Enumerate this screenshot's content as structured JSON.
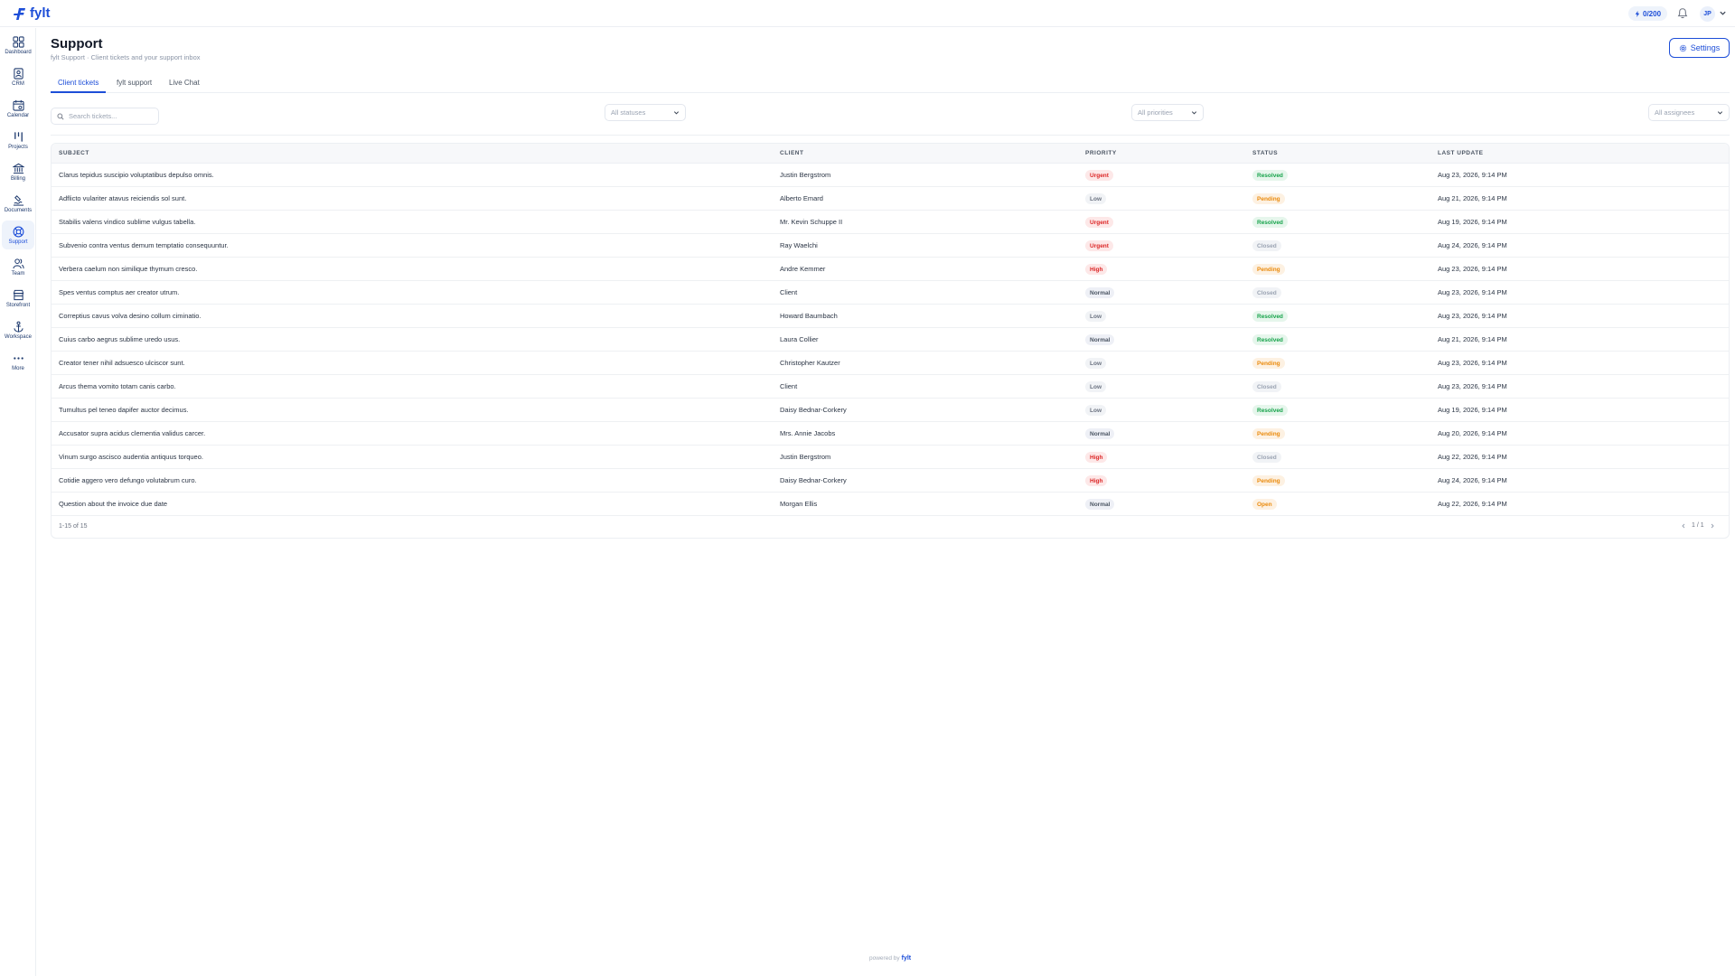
{
  "app": {
    "logo_text": "fylt",
    "credits": "0/200",
    "avatar_initials": "JP"
  },
  "colors": {
    "accent": "#1d4ed8",
    "urgent": "#dc2626",
    "resolved": "#16a34a",
    "pending": "#ea8a0c"
  },
  "sidebar": {
    "items": [
      {
        "label": "Dashboard",
        "icon": "dashboard-icon",
        "active": false
      },
      {
        "label": "CRM",
        "icon": "crm-icon",
        "active": false
      },
      {
        "label": "Calendar",
        "icon": "calendar-icon",
        "active": false
      },
      {
        "label": "Projects",
        "icon": "projects-icon",
        "active": false
      },
      {
        "label": "Billing",
        "icon": "billing-icon",
        "active": false
      },
      {
        "label": "Documents",
        "icon": "documents-icon",
        "active": false
      },
      {
        "label": "Support",
        "icon": "support-icon",
        "active": true
      },
      {
        "label": "Team",
        "icon": "team-icon",
        "active": false
      },
      {
        "label": "Storefront",
        "icon": "storefront-icon",
        "active": false
      },
      {
        "label": "Workspace",
        "icon": "workspace-icon",
        "active": false
      },
      {
        "label": "More",
        "icon": "more-icon",
        "active": false
      }
    ]
  },
  "header": {
    "title": "Support",
    "subtitle": "fylt Support · Client tickets and your support inbox",
    "settings_label": "Settings"
  },
  "tabs": [
    {
      "label": "Client tickets",
      "active": true
    },
    {
      "label": "fylt support",
      "active": false
    },
    {
      "label": "Live Chat",
      "active": false
    }
  ],
  "filters": {
    "search_placeholder": "Search tickets...",
    "status": "All statuses",
    "priority": "All priorities",
    "assignee": "All assignees"
  },
  "table": {
    "columns": [
      "SUBJECT",
      "CLIENT",
      "PRIORITY",
      "STATUS",
      "LAST UPDATE"
    ],
    "rows": [
      {
        "subject": "Clarus tepidus suscipio voluptatibus depulso omnis.",
        "client": "Justin Bergstrom",
        "priority": "Urgent",
        "status": "Resolved",
        "updated": "Aug 23, 2026, 9:14 PM"
      },
      {
        "subject": "Adflicto vulariter atavus reiciendis sol sunt.",
        "client": "Alberto Emard",
        "priority": "Low",
        "status": "Pending",
        "updated": "Aug 21, 2026, 9:14 PM"
      },
      {
        "subject": "Stabilis valens vindico sublime vulgus tabella.",
        "client": "Mr. Kevin Schuppe II",
        "priority": "Urgent",
        "status": "Resolved",
        "updated": "Aug 19, 2026, 9:14 PM"
      },
      {
        "subject": "Subvenio contra ventus demum temptatio consequuntur.",
        "client": "Ray Waelchi",
        "priority": "Urgent",
        "status": "Closed",
        "updated": "Aug 24, 2026, 9:14 PM"
      },
      {
        "subject": "Verbera caelum non similique thymum cresco.",
        "client": "Andre Kemmer",
        "priority": "High",
        "status": "Pending",
        "updated": "Aug 23, 2026, 9:14 PM"
      },
      {
        "subject": "Spes ventus comptus aer creator utrum.",
        "client": "Client",
        "priority": "Normal",
        "status": "Closed",
        "updated": "Aug 23, 2026, 9:14 PM"
      },
      {
        "subject": "Correptius cavus volva desino collum ciminatio.",
        "client": "Howard Baumbach",
        "priority": "Low",
        "status": "Resolved",
        "updated": "Aug 23, 2026, 9:14 PM"
      },
      {
        "subject": "Cuius carbo aegrus sublime uredo usus.",
        "client": "Laura Collier",
        "priority": "Normal",
        "status": "Resolved",
        "updated": "Aug 21, 2026, 9:14 PM"
      },
      {
        "subject": "Creator tener nihil adsuesco ulciscor sunt.",
        "client": "Christopher Kautzer",
        "priority": "Low",
        "status": "Pending",
        "updated": "Aug 23, 2026, 9:14 PM"
      },
      {
        "subject": "Arcus thema vomito totam canis carbo.",
        "client": "Client",
        "priority": "Low",
        "status": "Closed",
        "updated": "Aug 23, 2026, 9:14 PM"
      },
      {
        "subject": "Tumultus pel teneo dapifer auctor decimus.",
        "client": "Daisy Bednar-Corkery",
        "priority": "Low",
        "status": "Resolved",
        "updated": "Aug 19, 2026, 9:14 PM"
      },
      {
        "subject": "Accusator supra acidus clementia validus carcer.",
        "client": "Mrs. Annie Jacobs",
        "priority": "Normal",
        "status": "Pending",
        "updated": "Aug 20, 2026, 9:14 PM"
      },
      {
        "subject": "Vinum surgo ascisco audentia antiquus torqueo.",
        "client": "Justin Bergstrom",
        "priority": "High",
        "status": "Closed",
        "updated": "Aug 22, 2026, 9:14 PM"
      },
      {
        "subject": "Cotidie aggero vero defungo volutabrum curo.",
        "client": "Daisy Bednar-Corkery",
        "priority": "High",
        "status": "Pending",
        "updated": "Aug 24, 2026, 9:14 PM"
      },
      {
        "subject": "Question about the invoice due date",
        "client": "Morgan Ellis",
        "priority": "Normal",
        "status": "Open",
        "updated": "Aug 22, 2026, 9:14 PM"
      }
    ],
    "count_text": "1-15 of 15",
    "page_text": "1 / 1"
  },
  "footer": {
    "powered_text": "powered by",
    "brand": "fylt"
  }
}
